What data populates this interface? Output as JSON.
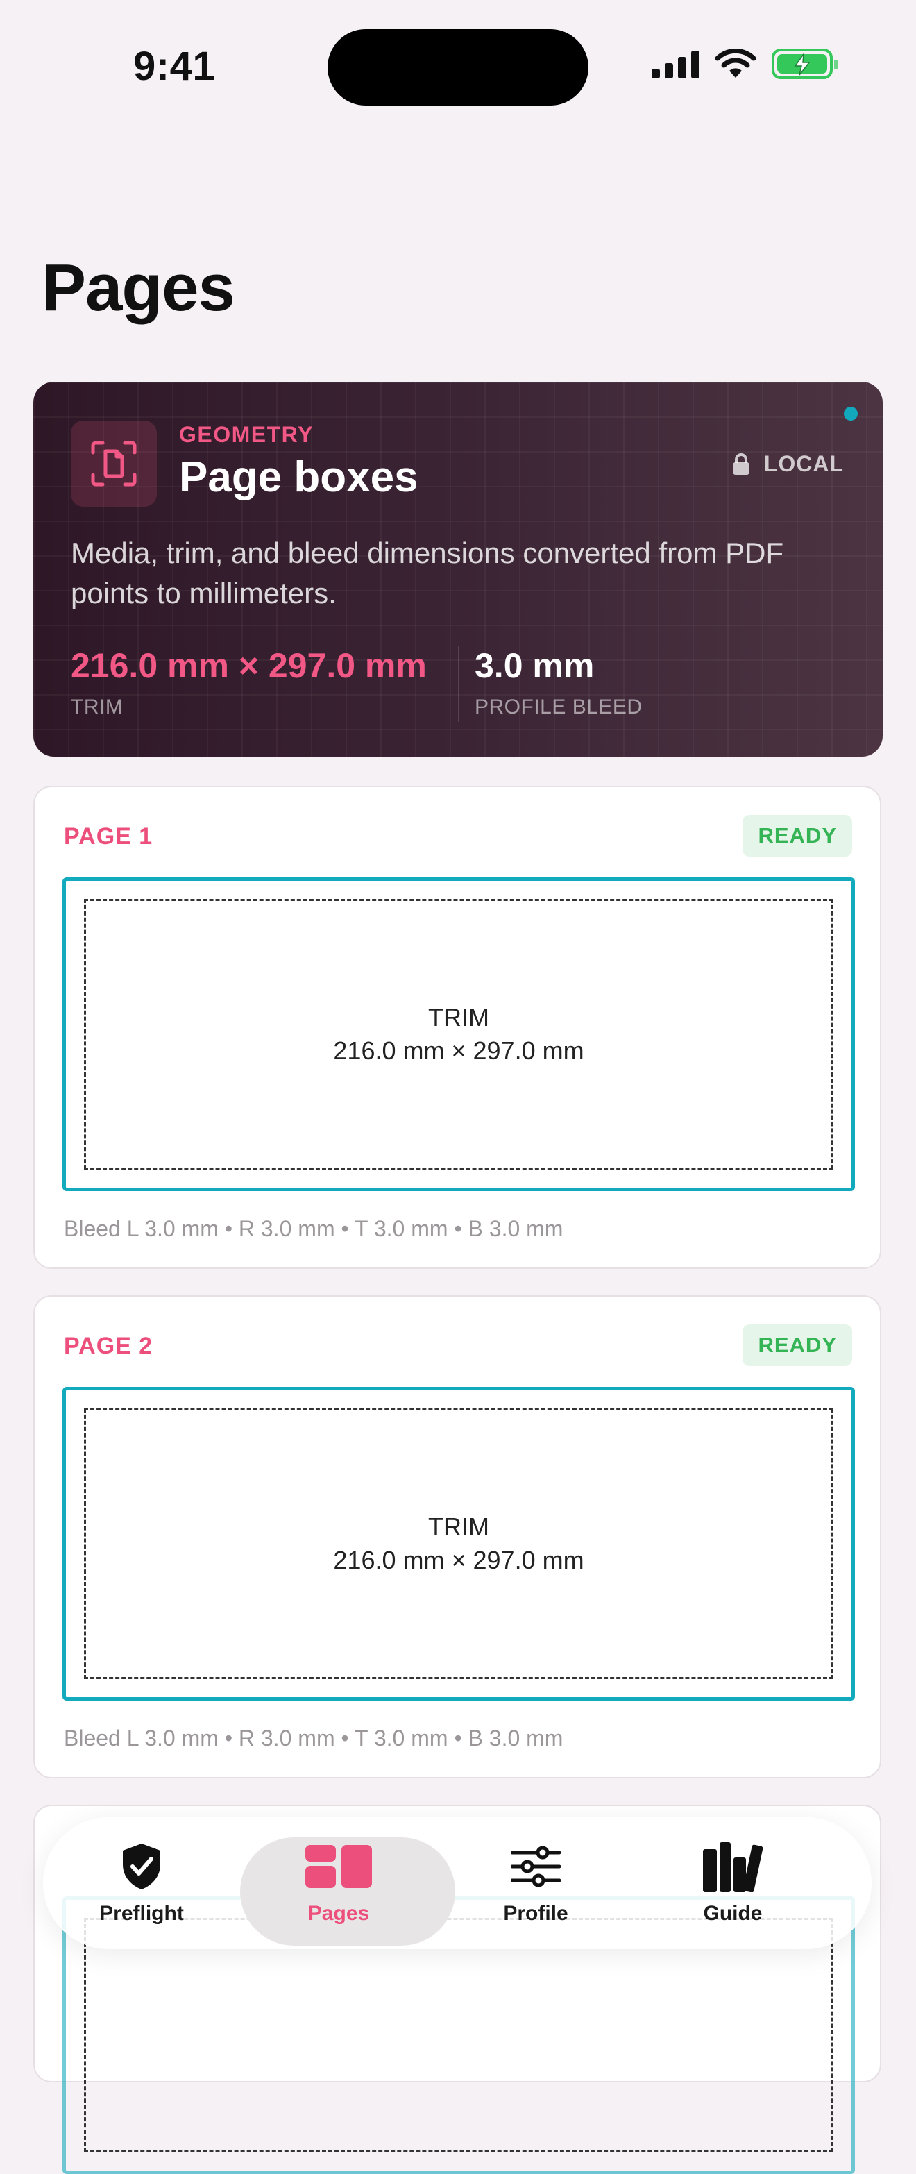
{
  "status_bar": {
    "time": "9:41"
  },
  "page_title": "Pages",
  "hero": {
    "eyebrow": "GEOMETRY",
    "title": "Page boxes",
    "badge": "LOCAL",
    "description": "Media, trim, and bleed dimensions converted from PDF points to millimeters.",
    "trim_value": "216.0 mm × 297.0 mm",
    "trim_label": "TRIM",
    "bleed_value": "3.0 mm",
    "bleed_label": "PROFILE BLEED",
    "icon": "document-scan-icon"
  },
  "pages": [
    {
      "label": "PAGE 1",
      "status": "READY",
      "trim_title": "TRIM",
      "trim_dims": "216.0 mm × 297.0 mm",
      "bleed": "Bleed L 3.0 mm • R 3.0 mm • T 3.0 mm • B 3.0 mm"
    },
    {
      "label": "PAGE 2",
      "status": "READY",
      "trim_title": "TRIM",
      "trim_dims": "216.0 mm × 297.0 mm",
      "bleed": "Bleed L 3.0 mm • R 3.0 mm • T 3.0 mm • B 3.0 mm"
    }
  ],
  "tabs": [
    {
      "label": "Preflight",
      "icon": "shield-check-icon",
      "active": false
    },
    {
      "label": "Pages",
      "icon": "pages-grid-icon",
      "active": true
    },
    {
      "label": "Profile",
      "icon": "sliders-icon",
      "active": false
    },
    {
      "label": "Guide",
      "icon": "books-icon",
      "active": false
    }
  ],
  "colors": {
    "accent": "#ec4f7b",
    "bleed": "#14aabd",
    "ready": "#34b455",
    "hero_bg": "#3b2434"
  }
}
